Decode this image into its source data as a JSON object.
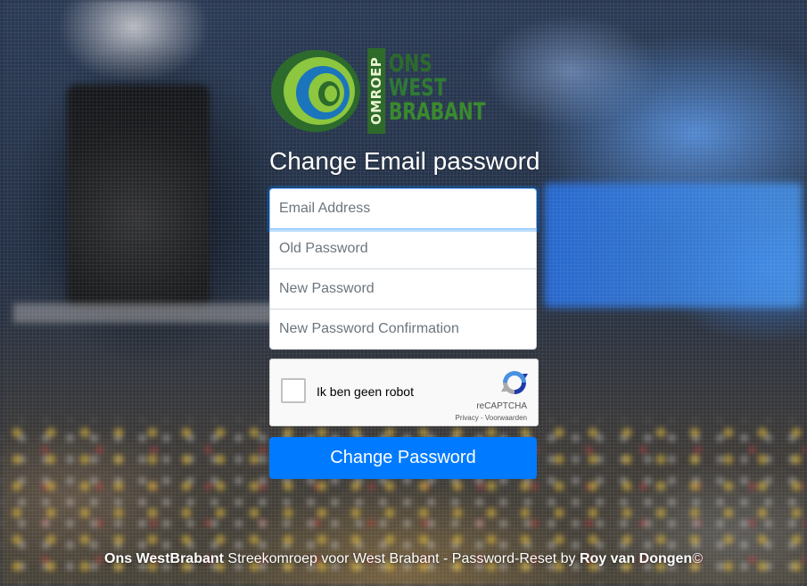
{
  "logo": {
    "vertical_text": "OMROEP",
    "line1": "ONS",
    "line2": "WEST",
    "line3": "BRABANT",
    "colors": {
      "dark_green": "#2c6b2c",
      "light_green": "#8dc63f",
      "blue": "#1b75bc"
    }
  },
  "page_title": "Change Email password",
  "form": {
    "email_placeholder": "Email Address",
    "old_password_placeholder": "Old Password",
    "new_password_placeholder": "New Password",
    "new_password_confirmation_placeholder": "New Password Confirmation",
    "submit_label": "Change Password"
  },
  "captcha": {
    "label": "Ik ben geen robot",
    "brand": "reCAPTCHA",
    "privacy_link": "Privacy",
    "separator": " - ",
    "terms_link": "Voorwaarden"
  },
  "footer": {
    "brand": "Ons WestBrabant",
    "middle_text": " Streekomroep voor West Brabant - Password-Reset by ",
    "author": "Roy van Dongen",
    "suffix": "©"
  },
  "colors": {
    "primary_button": "#007bff",
    "title_text": "#ffffff"
  }
}
